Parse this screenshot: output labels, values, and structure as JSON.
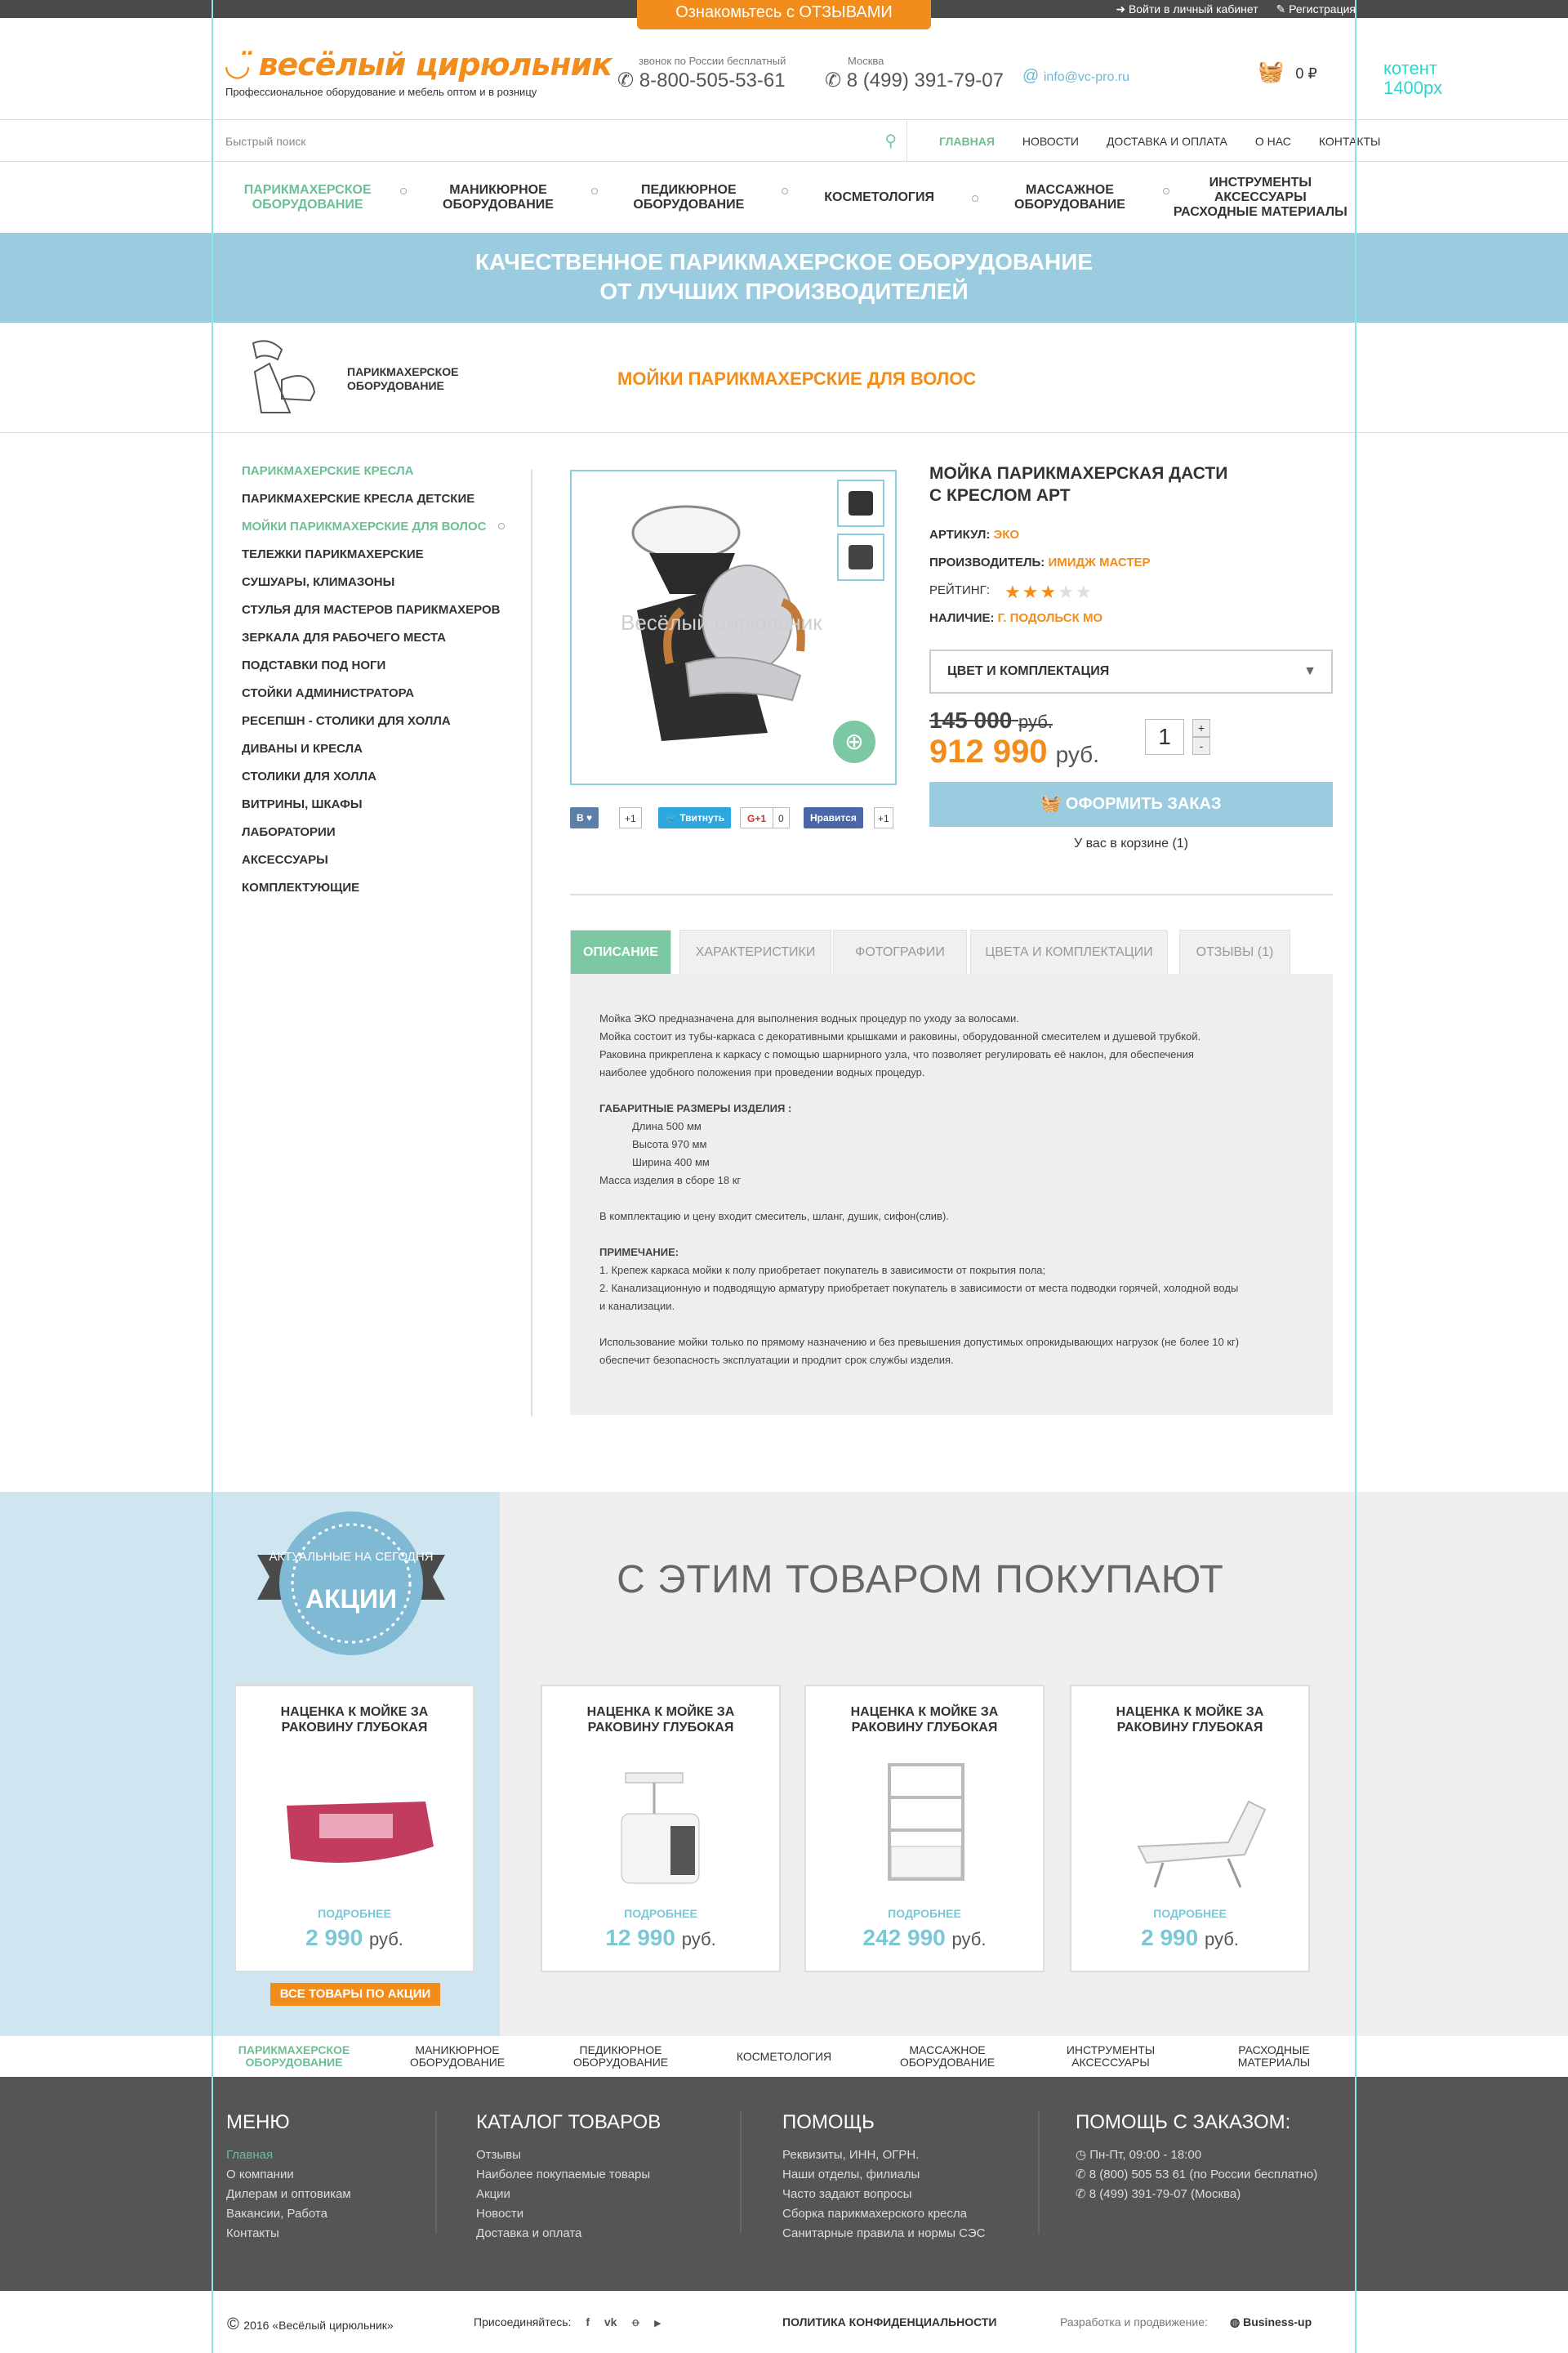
{
  "topbar": {
    "promo": "Ознакомьтесь с  ОТЗЫВАМИ",
    "login": "Войти в личный кабинет",
    "register": "Регистрация"
  },
  "header": {
    "logo_name": "весёлый цирюльник",
    "logo_sub": "Профессиональное оборудование и мебель оптом и в розницу",
    "phone1_label": "звонок по России бесплатный",
    "phone1": "8-800-505-53-61",
    "phone2_label": "Москва",
    "phone2": "8 (499) 391-79-07",
    "email": "info@vc-pro.ru",
    "cart_total": "0 ₽",
    "content_note_1": "котент",
    "content_note_2": "1400px"
  },
  "search": {
    "placeholder": "Быстрый поиск"
  },
  "mainnav": [
    "ГЛАВНАЯ",
    "НОВОСТИ",
    "ДОСТАВКА И ОПЛАТА",
    "О НАС",
    "КОНТАКТЫ"
  ],
  "catnav": [
    {
      "l1": "ПАРИКМАХЕРСКОЕ",
      "l2": "ОБОРУДОВАНИЕ"
    },
    {
      "l1": "МАНИКЮРНОЕ",
      "l2": "ОБОРУДОВАНИЕ"
    },
    {
      "l1": "ПЕДИКЮРНОЕ",
      "l2": "ОБОРУДОВАНИЕ"
    },
    {
      "l1": "КОСМЕТОЛОГИЯ",
      "l2": ""
    },
    {
      "l1": "МАССАЖНОЕ",
      "l2": "ОБОРУДОВАНИЕ"
    },
    {
      "l1": "ИНСТРУМЕНТЫ АКСЕССУАРЫ",
      "l2": "РАСХОДНЫЕ МАТЕРИАЛЫ"
    }
  ],
  "banner": {
    "l1": "КАЧЕСТВЕННОЕ ПАРИКМАХЕРСКОЕ ОБОРУДОВАНИЕ",
    "l2": "ОТ ЛУЧШИХ ПРОИЗВОДИТЕЛЕЙ"
  },
  "crumb": {
    "cat_l1": "ПАРИКМАХЕРСКОЕ",
    "cat_l2": "ОБОРУДОВАНИЕ",
    "title": "МОЙКИ ПАРИКМАХЕРСКИЕ ДЛЯ ВОЛОС"
  },
  "sidebar": [
    "ПАРИКМАХЕРСКИЕ КРЕСЛА",
    "ПАРИКМАХЕРСКИЕ КРЕСЛА ДЕТСКИЕ",
    "МОЙКИ ПАРИКМАХЕРСКИЕ ДЛЯ ВОЛОС",
    "ТЕЛЕЖКИ ПАРИКМАХЕРСКИЕ",
    "СУШУАРЫ, КЛИМАЗОНЫ",
    "СТУЛЬЯ ДЛЯ МАСТЕРОВ ПАРИКМАХЕРОВ",
    "ЗЕРКАЛА ДЛЯ РАБОЧЕГО МЕСТА",
    "ПОДСТАВКИ ПОД НОГИ",
    "СТОЙКИ АДМИНИСТРАТОРА",
    "РЕСЕПШН - СТОЛИКИ ДЛЯ ХОЛЛА",
    "ДИВАНЫ И КРЕСЛА",
    "СТОЛИКИ ДЛЯ ХОЛЛА",
    "ВИТРИНЫ, ШКАФЫ",
    "ЛАБОРАТОРИИ",
    "АКСЕССУАРЫ",
    "КОМПЛЕКТУЮЩИЕ"
  ],
  "product": {
    "title_l1": "МОЙКА ПАРИКМАХЕРСКАЯ ДАСТИ",
    "title_l2": "С КРЕСЛОМ АРТ",
    "article_label": "АРТИКУЛ:",
    "article": "ЭКО",
    "maker_label": "ПРОИЗВОДИТЕЛЬ:",
    "maker": "ИМИДЖ МАСТЕР",
    "rating_label": "РЕЙТИНГ:",
    "rating": 3,
    "rating_max": 5,
    "stock_label": "НАЛИЧИЕ:",
    "stock": "Г. ПОДОЛЬСК МО",
    "color_select": "ЦВЕТ И КОМПЛЕКТАЦИЯ",
    "old_price": "145 000",
    "old_cur": "руб.",
    "price": "912 990",
    "cur": "руб.",
    "qty": "1",
    "order": "ОФОРМИТЬ ЗАКАЗ",
    "in_cart": "У вас в корзине (1)",
    "watermark": "Весёлый цирюльник"
  },
  "social": {
    "vk": "В",
    "vk_count": "+1",
    "tw": "Твитнуть",
    "gp": "G+1",
    "gp_count": "0",
    "fb": "Нравится",
    "fb_count": "+1"
  },
  "tabs": [
    "ОПИСАНИЕ",
    "ХАРАКТЕРИСТИКИ",
    "ФОТОГРАФИИ",
    "ЦВЕТА И КОМПЛЕКТАЦИИ",
    "ОТЗЫВЫ (1)"
  ],
  "desc": {
    "p1": "Мойка ЭКО предназначена для выполнения водных процедур по уходу за волосами.",
    "p2": "Мойка состоит из тубы-каркаса с декоративными крышками и раковины, оборудованной смесителем и душевой трубкой.",
    "p3": "Раковина прикреплена к каркасу с помощью шарнирного узла, что позволяет регулировать её наклон, для обеспечения",
    "p4": "наиболее удобного положения при проведении водных процедур.",
    "dims_h": "ГАБАРИТНЫЕ РАЗМЕРЫ ИЗДЕЛИЯ :",
    "d1": "Длина 500 мм",
    "d2": "Высота 970 мм",
    "d3": "Ширина 400 мм",
    "mass": "Масса изделия в сборе 18 кг",
    "kit": "В комплектацию и цену входит смеситель, шланг, душик, сифон(слив).",
    "note_h": "ПРИМЕЧАНИЕ:",
    "n1": "1. Крепеж каркаса мойки к полу приобретает покупатель в зависимости от покрытия пола;",
    "n2": "2. Канализационную и подводящую арматуру приобретает покупатель в зависимости от места подводки горячей, холодной воды",
    "n3": "и канализации.",
    "u1": "Использование мойки только по прямому назначению и без превышения допустимых опрокидывающих нагрузок (не более 10 кг)",
    "u2": "обеспечит безопасность эксплуатации и продлит срок службы изделия."
  },
  "promo": {
    "badge_top": "АКТУАЛЬНЫЕ НА СЕГОДНЯ",
    "badge_main": "АКЦИИ",
    "also_title": "С ЭТИМ ТОВАРОМ ПОКУПАЮТ",
    "all_button": "ВСЕ ТОВАРЫ ПО АКЦИИ",
    "cards": [
      {
        "t1": "НАЦЕНКА К МОЙКЕ ЗА",
        "t2": "РАКОВИНУ ГЛУБОКАЯ",
        "more": "ПОДРОБНЕЕ",
        "price": "2 990",
        "cur": "руб."
      },
      {
        "t1": "НАЦЕНКА К МОЙКЕ ЗА",
        "t2": "РАКОВИНУ ГЛУБОКАЯ",
        "more": "ПОДРОБНЕЕ",
        "price": "12 990",
        "cur": "руб."
      },
      {
        "t1": "НАЦЕНКА К МОЙКЕ ЗА",
        "t2": "РАКОВИНУ ГЛУБОКАЯ",
        "more": "ПОДРОБНЕЕ",
        "price": "242 990",
        "cur": "руб."
      },
      {
        "t1": "НАЦЕНКА К МОЙКЕ ЗА",
        "t2": "РАКОВИНУ ГЛУБОКАЯ",
        "more": "ПОДРОБНЕЕ",
        "price": "2 990",
        "cur": "руб."
      }
    ]
  },
  "botnav": [
    {
      "l1": "ПАРИКМАХЕРСКОЕ",
      "l2": "ОБОРУДОВАНИЕ"
    },
    {
      "l1": "МАНИКЮРНОЕ",
      "l2": "ОБОРУДОВАНИЕ"
    },
    {
      "l1": "ПЕДИКЮРНОЕ",
      "l2": "ОБОРУДОВАНИЕ"
    },
    {
      "l1": "КОСМЕТОЛОГИЯ",
      "l2": ""
    },
    {
      "l1": "МАССАЖНОЕ",
      "l2": "ОБОРУДОВАНИЕ"
    },
    {
      "l1": "ИНСТРУМЕНТЫ",
      "l2": "АКСЕССУАРЫ"
    },
    {
      "l1": "РАСХОДНЫЕ",
      "l2": "МАТЕРИАЛЫ"
    }
  ],
  "footer": {
    "menu_h": "МЕНЮ",
    "menu": [
      "Главная",
      "О компании",
      "Дилерам и оптовикам",
      "Вакансии, Работа",
      "Контакты"
    ],
    "cat_h": "КАТАЛОГ ТОВАРОВ",
    "cat": [
      "Отзывы",
      "Наиболее покупаемые товары",
      "Акции",
      "Новости",
      "Доставка и оплата"
    ],
    "help_h": "ПОМОЩЬ",
    "help": [
      "Реквизиты, ИНН, ОГРН.",
      "Наши отделы, филиалы",
      "Часто задают вопросы",
      "Сборка парикмахерского кресла",
      "Санитарные правила и нормы СЭС"
    ],
    "order_h": "ПОМОЩЬ С ЗАКАЗОМ:",
    "order": [
      "Пн-Пт, 09:00 - 18:00",
      "8 (800) 505 53 61 (по России бесплатно)",
      "8 (499) 391-79-07 (Москва)"
    ]
  },
  "copy": {
    "c": "2016 «Весёлый цирюльник»",
    "join": "Присоединяйтесь:",
    "policy": "ПОЛИТИКА КОНФИДЕНЦИАЛЬНОСТИ",
    "dev": "Разработка и продвижение:",
    "dev_name": "Business-up"
  },
  "colors": {
    "accent": "#f28c1a",
    "green": "#6cbf94",
    "blue": "#9bcbdf",
    "footer": "#555555"
  }
}
